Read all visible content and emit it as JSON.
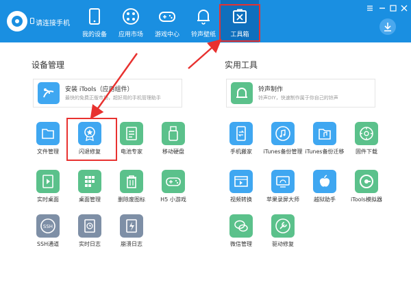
{
  "header": {
    "connect_text": "请连接手机",
    "nav": [
      {
        "key": "my-device",
        "label": "我的设备"
      },
      {
        "key": "app-market",
        "label": "应用市场"
      },
      {
        "key": "game-center",
        "label": "游戏中心"
      },
      {
        "key": "ringtone-wallpaper",
        "label": "铃声壁纸"
      },
      {
        "key": "toolbox",
        "label": "工具箱"
      }
    ]
  },
  "sections": {
    "device_mgmt": "设备管理",
    "utilities": "实用工具"
  },
  "banners": {
    "install": {
      "title": "安装 iTools（应用组件）",
      "desc": "最快的免费正版市场，超好用的手机管理助手"
    },
    "ringtone": {
      "title": "铃声制作",
      "desc": "铃声DIY，快速制作属于你自己的铃声"
    }
  },
  "device_tools": [
    {
      "label": "文件管理",
      "color": "#3fa7f1"
    },
    {
      "label": "闪退修复",
      "color": "#3fa7f1"
    },
    {
      "label": "电池专家",
      "color": "#5bc18b"
    },
    {
      "label": "移动硬盘",
      "color": "#5bc18b"
    },
    {
      "label": "实时桌面",
      "color": "#5bc18b"
    },
    {
      "label": "桌面管理",
      "color": "#5bc18b"
    },
    {
      "label": "删除废图标",
      "color": "#5bc18b"
    },
    {
      "label": "H5 小游戏",
      "color": "#5bc18b"
    },
    {
      "label": "SSH通道",
      "color": "#7e8fa6"
    },
    {
      "label": "实时日志",
      "color": "#7e8fa6"
    },
    {
      "label": "崩溃日志",
      "color": "#7e8fa6"
    }
  ],
  "utility_tools": [
    {
      "label": "手机搬家",
      "color": "#3fa7f1"
    },
    {
      "label": "iTunes备份管理",
      "color": "#3fa7f1"
    },
    {
      "label": "iTunes备份迁移",
      "color": "#3fa7f1"
    },
    {
      "label": "固件下载",
      "color": "#5bc18b"
    },
    {
      "label": "视频转换",
      "color": "#3fa7f1"
    },
    {
      "label": "苹果录屏大师",
      "color": "#3fa7f1"
    },
    {
      "label": "越狱助手",
      "color": "#3fa7f1"
    },
    {
      "label": "iTools模拟器",
      "color": "#5bc18b"
    },
    {
      "label": "微信管理",
      "color": "#5bc18b"
    },
    {
      "label": "驱动修复",
      "color": "#5bc18b"
    }
  ],
  "colors": {
    "header": "#1a8fe1",
    "active_tab": "#0f6fbd",
    "highlight": "#e8312f"
  }
}
